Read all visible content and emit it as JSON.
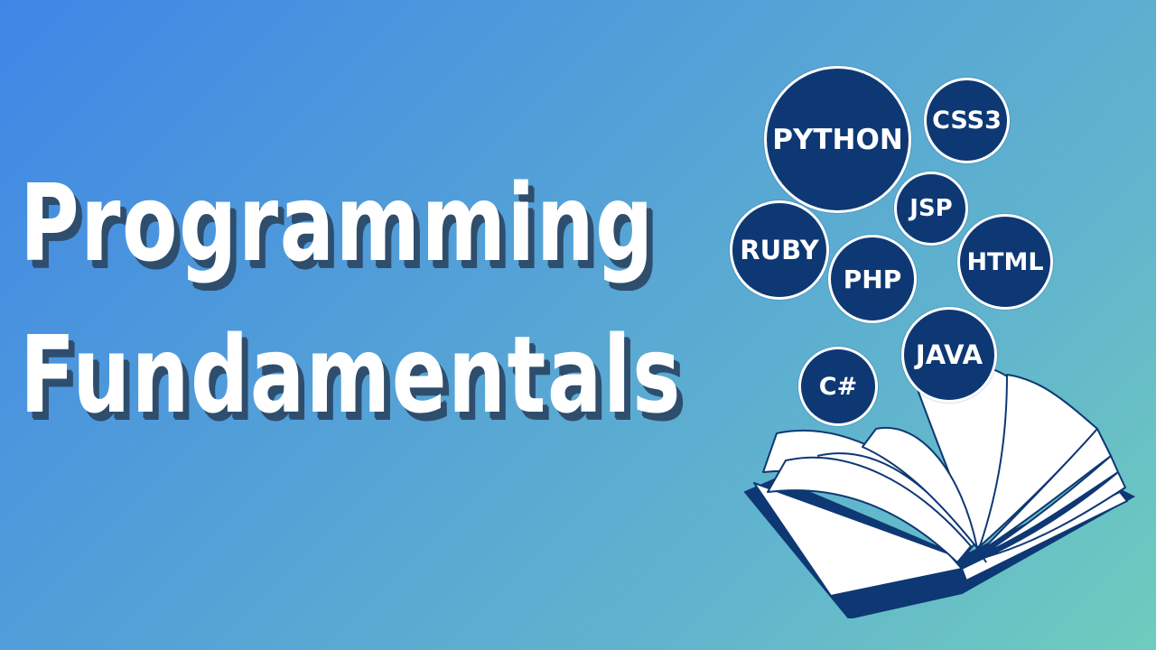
{
  "title": {
    "line1": "Programming",
    "line2": "Fundamentals"
  },
  "bubbles": [
    {
      "id": "python",
      "label": "PYTHON"
    },
    {
      "id": "css3",
      "label": "CSS3"
    },
    {
      "id": "jsp",
      "label": "JSP"
    },
    {
      "id": "ruby",
      "label": "RUBY"
    },
    {
      "id": "php",
      "label": "PHP"
    },
    {
      "id": "html",
      "label": "HTML"
    },
    {
      "id": "java",
      "label": "JAVA"
    },
    {
      "id": "csharp",
      "label": "C#"
    }
  ],
  "icons": {
    "book": "open-book-icon"
  },
  "colors": {
    "background_start": "#3f86e6",
    "background_end": "#6fccbd",
    "bubble": "#0e3874",
    "title_text": "#ffffff",
    "title_shadow": "#2f4e6d",
    "book_cover": "#0e3874",
    "book_pages": "#ffffff"
  }
}
